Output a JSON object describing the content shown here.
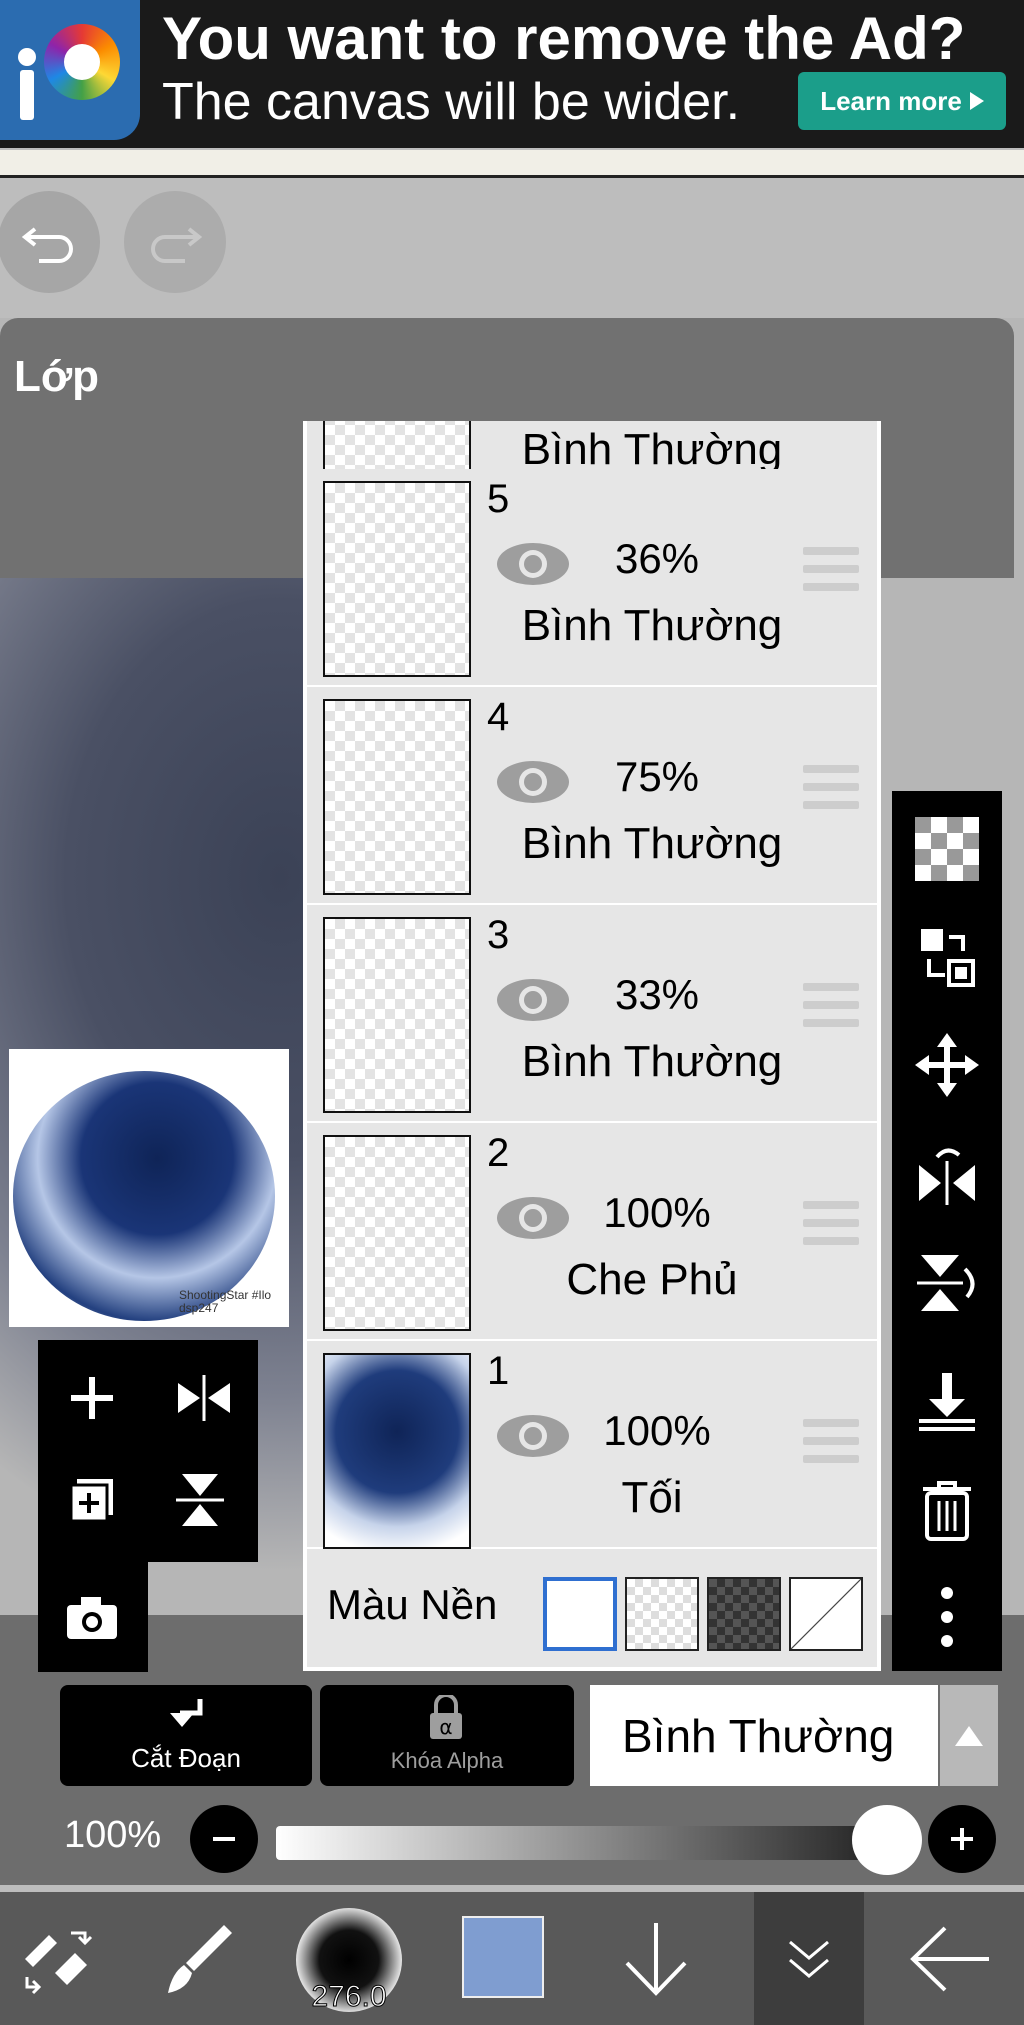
{
  "ad": {
    "title": "You want to remove the Ad?",
    "subtitle": "The canvas will be wider.",
    "button_label": "Learn more"
  },
  "panel": {
    "title": "Lớp"
  },
  "layers": {
    "partial_blend": "Bình Thường",
    "rows": [
      {
        "number": "5",
        "opacity": "36%",
        "blend": "Bình Thường"
      },
      {
        "number": "4",
        "opacity": "75%",
        "blend": "Bình Thường"
      },
      {
        "number": "3",
        "opacity": "33%",
        "blend": "Bình Thường"
      },
      {
        "number": "2",
        "opacity": "100%",
        "blend": "Che Phủ"
      },
      {
        "number": "1",
        "opacity": "100%",
        "blend": "Tối"
      }
    ],
    "background_label": "Màu Nền"
  },
  "thumbnail_watermark": "ShootingStar #Ilo dsp247",
  "actions": {
    "clipping_label": "Cắt Đoạn",
    "alpha_lock_label": "Khóa Alpha",
    "blend_mode": "Bình Thường"
  },
  "opacity": {
    "label": "100%",
    "value": 1.0
  },
  "toolbar": {
    "brush_size": "276.0",
    "color": "#7f9dd0"
  },
  "colors": {
    "ad_button": "#1b9e8a",
    "selected_swatch_border": "#2f6fd0"
  }
}
